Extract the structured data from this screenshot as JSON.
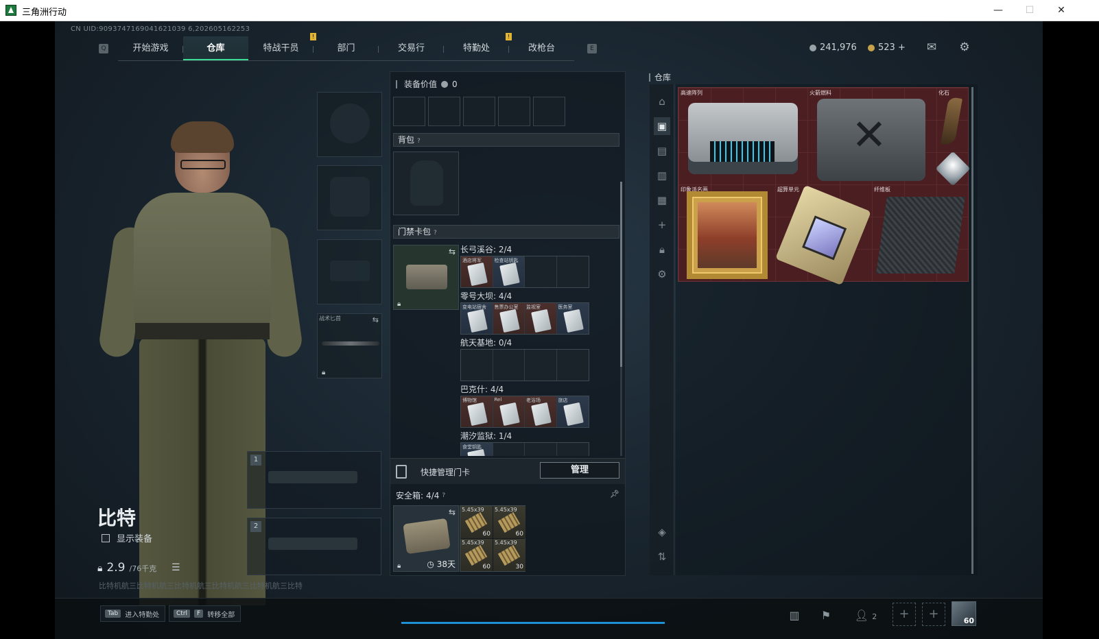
{
  "window": {
    "title": "三角洲行动",
    "minimize": "—",
    "maximize": "☐",
    "close": "✕"
  },
  "game": {
    "uid": "CN UID:9093747169041621039 6,202605162253",
    "nav": {
      "left_key": "Q",
      "right_key": "E",
      "tabs": [
        {
          "label": "开始游戏"
        },
        {
          "label": "仓库",
          "active": true
        },
        {
          "label": "特战干员",
          "mark": "!"
        },
        {
          "label": "部门"
        },
        {
          "label": "交易行"
        },
        {
          "label": "特勤处",
          "mark": "!"
        },
        {
          "label": "改枪台"
        }
      ]
    },
    "currency": {
      "silver": "241,976",
      "gold": "523 +",
      "silver_color": "#9aa3a8",
      "gold_color": "#c7a24a"
    },
    "character": {
      "name": "比特",
      "show_equip": "显示装备",
      "weight_value": "2.9",
      "weight_total": "/76千克",
      "footer": "比特机航三比特机航三比特机航三比特机航三比特机航三比特"
    },
    "equipment_slots": {
      "knife_label": "战术匕首",
      "weapon_1": "1",
      "weapon_2": "2"
    },
    "middle": {
      "equip_value_label": "装备价值",
      "equip_value": "0",
      "backpack_label": "背包",
      "cardbag_label": "门禁卡包",
      "card_groups": [
        {
          "title": "长弓溪谷: 2/4",
          "cards": [
            {
              "name": "酒店将军",
              "color": "red"
            },
            {
              "name": "检查站钥匙",
              "color": "blue"
            },
            null,
            null
          ]
        },
        {
          "title": "零号大坝: 4/4",
          "cards": [
            {
              "name": "变电站宿舍",
              "color": "blue"
            },
            {
              "name": "售票办公室",
              "color": "red"
            },
            {
              "name": "监视室",
              "color": "red"
            },
            {
              "name": "医务室",
              "color": "blue"
            }
          ]
        },
        {
          "title": "航天基地: 0/4",
          "cards": [
            null,
            null,
            null,
            null
          ]
        },
        {
          "title": "巴克什: 4/4",
          "cards": [
            {
              "name": "博物馆",
              "color": "red"
            },
            {
              "name": "Rel",
              "color": "red"
            },
            {
              "name": "老浴场",
              "color": "red"
            },
            {
              "name": "旅店",
              "color": "blue"
            }
          ]
        },
        {
          "title": "潮汐监狱: 1/4",
          "cards": [
            {
              "name": "食堂钥匙",
              "color": "blue"
            },
            null,
            null,
            null
          ]
        }
      ],
      "quick_manage_label": "快捷管理门卡",
      "manage_button": "管理",
      "safe_label": "安全箱:",
      "safe_count": "4/4",
      "safe_days": "38天",
      "ammo": [
        {
          "name": "5.45x39",
          "count": "60"
        },
        {
          "name": "5.45x39",
          "count": "60"
        },
        {
          "name": "5.45x39",
          "count": "60"
        },
        {
          "name": "5.45x39",
          "count": "30"
        }
      ]
    },
    "stash": {
      "title": "仓库",
      "items": {
        "rack": "高速阵列",
        "fuel": "火箭燃料",
        "fossil": "化石",
        "painting": "印象派名画",
        "cpu": "超算单元",
        "fiber": "纤维板"
      }
    },
    "bottom": {
      "hint1_key": "Tab",
      "hint1_text": "进入特勤处",
      "hint2_key1": "Ctrl",
      "hint2_key2": "F",
      "hint2_text": "转移全部",
      "friends_count": "2",
      "level": "60"
    }
  }
}
